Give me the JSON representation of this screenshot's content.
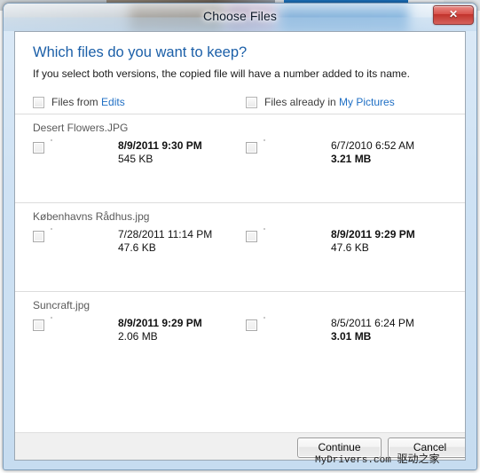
{
  "window": {
    "title": "Choose Files",
    "close_label": "✕",
    "close_icon": "close-icon"
  },
  "header": {
    "heading": "Which files do you want to keep?",
    "subheading": "If you select both versions, the copied file will have a number added to its name."
  },
  "columns": {
    "left": {
      "prefix": "Files from ",
      "link": "Edits"
    },
    "right": {
      "prefix": "Files already in ",
      "link": "My Pictures"
    }
  },
  "groups": [
    {
      "name": "Desert Flowers.JPG",
      "thumb": "desert-flowers-thumbnail",
      "left": {
        "date": "8/9/2011 9:30 PM",
        "size": "545 KB",
        "date_bold": true,
        "size_bold": false
      },
      "right": {
        "date": "6/7/2010 6:52 AM",
        "size": "3.21 MB",
        "date_bold": false,
        "size_bold": true
      }
    },
    {
      "name": "Københavns Rådhus.jpg",
      "thumb": "copenhagen-tower-thumbnail",
      "left": {
        "date": "7/28/2011 11:14 PM",
        "size": "47.6 KB",
        "date_bold": false,
        "size_bold": false
      },
      "right": {
        "date": "8/9/2011 9:29 PM",
        "size": "47.6 KB",
        "date_bold": true,
        "size_bold": false
      }
    },
    {
      "name": "Suncraft.jpg",
      "thumb": "suncraft-thumbnail",
      "left": {
        "date": "8/9/2011 9:29 PM",
        "size": "2.06 MB",
        "date_bold": true,
        "size_bold": false
      },
      "right": {
        "date": "8/5/2011 6:24 PM",
        "size": "3.01 MB",
        "date_bold": false,
        "size_bold": true
      }
    }
  ],
  "footer": {
    "continue_label": "Continue",
    "cancel_label": "Cancel"
  },
  "watermark": {
    "site": "MyDrivers.com",
    "cn": "驱动之家"
  },
  "colors": {
    "heading_blue": "#1b5fa8",
    "link_blue": "#1f6fc4",
    "close_red": "#c1332c",
    "footer_grey": "#f0f0f0"
  }
}
